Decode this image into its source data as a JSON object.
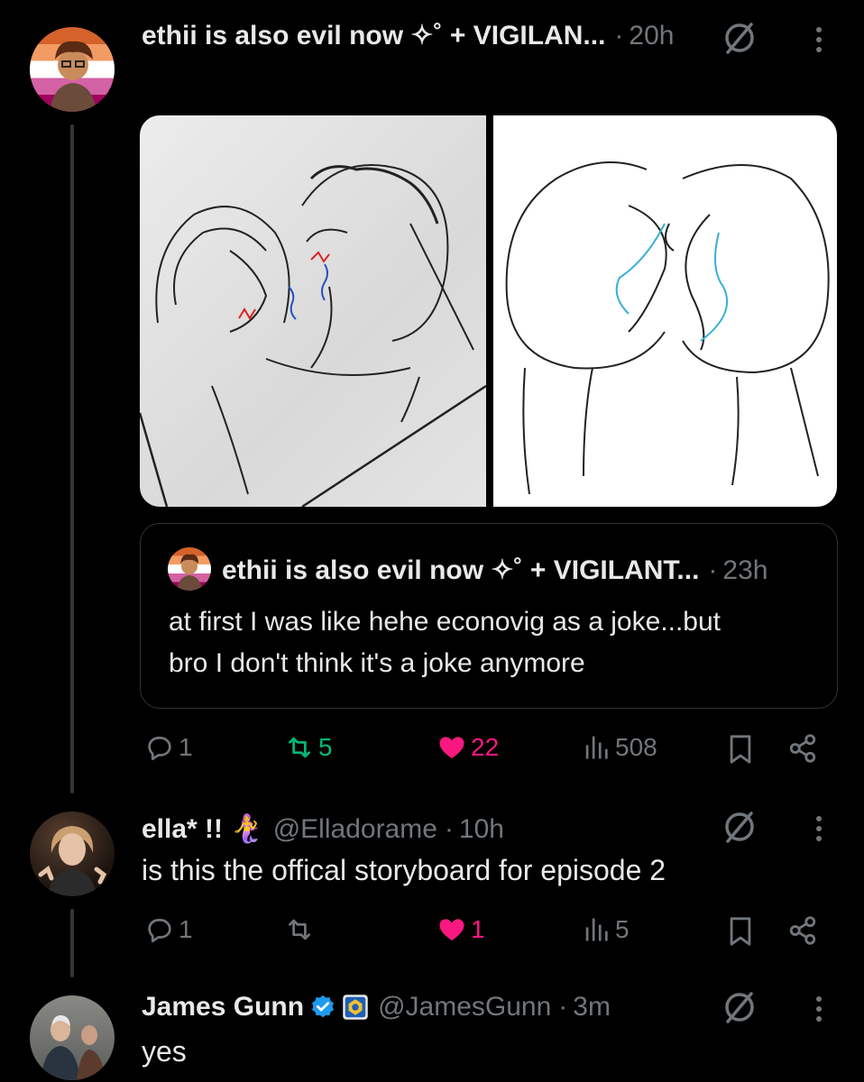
{
  "post": {
    "author": "ethii is also evil now ✧˚ + VIGILAN...",
    "separator": "·",
    "time": "20h",
    "quote": {
      "author": "ethii is also evil now ✧˚ + VIGILANT...",
      "separator": "·",
      "time": "23h",
      "text_line1": "at first I was like hehe econovig as a joke...but",
      "text_line2": "bro I don't think it's a joke anymore"
    },
    "actions": {
      "replies": "1",
      "reposts": "5",
      "likes": "22",
      "views": "508"
    }
  },
  "reply1": {
    "name": "ella* !! 🧜‍♀️",
    "handle": "@Elladorame",
    "separator": "·",
    "time": "10h",
    "text": "is this the offical storyboard for episode 2",
    "actions": {
      "replies": "1",
      "reposts": "",
      "likes": "1",
      "views": "5"
    }
  },
  "reply2": {
    "name": "James Gunn",
    "handle": "@JamesGunn",
    "separator": "·",
    "time": "3m",
    "text": "yes"
  },
  "colors": {
    "background": "#000000",
    "text": "#e7e9ea",
    "muted": "#71767b",
    "repost_green": "#00ba7c",
    "like_pink": "#f91880",
    "verified_blue": "#1d9bf0"
  },
  "icons": [
    "grok-icon",
    "more-icon",
    "reply-icon",
    "repost-icon",
    "like-icon",
    "views-icon",
    "bookmark-icon",
    "share-icon",
    "verified-icon"
  ]
}
